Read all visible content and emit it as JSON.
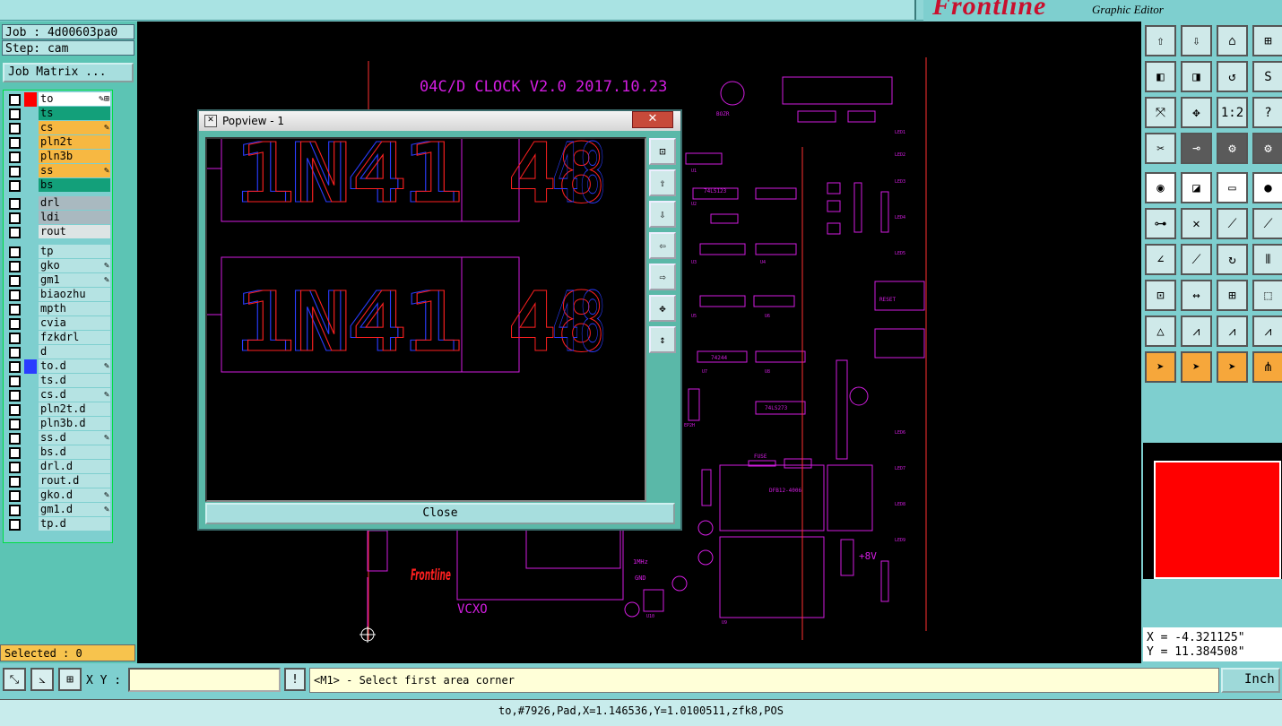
{
  "app": {
    "brand": "Frontline",
    "subtitle": "Graphic Editor"
  },
  "job": {
    "job_line": "Job : 4d00603pa0",
    "step_line": "Step: cam",
    "matrix_button": "Job Matrix ..."
  },
  "layer_groups": [
    [
      {
        "name": "to",
        "color": "#ff0000",
        "bg": "#ffffff",
        "edit": "✎⊞"
      },
      {
        "name": "ts",
        "color": "",
        "bg": "#13a07a",
        "edit": ""
      },
      {
        "name": "cs",
        "color": "",
        "bg": "#f7b842",
        "edit": "✎"
      },
      {
        "name": "pln2t",
        "color": "",
        "bg": "#f7b842",
        "edit": ""
      },
      {
        "name": "pln3b",
        "color": "",
        "bg": "#f7b842",
        "edit": ""
      },
      {
        "name": "ss",
        "color": "",
        "bg": "#f7b842",
        "edit": "✎"
      },
      {
        "name": "bs",
        "color": "",
        "bg": "#13a07a",
        "edit": ""
      }
    ],
    [
      {
        "name": "drl",
        "color": "",
        "bg": "#a9b9c0",
        "edit": ""
      },
      {
        "name": "ldi",
        "color": "",
        "bg": "#a9b9c0",
        "edit": ""
      },
      {
        "name": "rout",
        "color": "",
        "bg": "#dde4e4",
        "edit": ""
      }
    ],
    [
      {
        "name": "tp",
        "color": "",
        "bg": "#b5e3e3",
        "edit": ""
      },
      {
        "name": "gko",
        "color": "",
        "bg": "#b5e3e3",
        "edit": "✎"
      },
      {
        "name": "gm1",
        "color": "",
        "bg": "#b5e3e3",
        "edit": "✎"
      },
      {
        "name": "biaozhu",
        "color": "",
        "bg": "#b5e3e3",
        "edit": ""
      },
      {
        "name": "mpth",
        "color": "",
        "bg": "#b5e3e3",
        "edit": ""
      },
      {
        "name": "cvia",
        "color": "",
        "bg": "#b5e3e3",
        "edit": ""
      },
      {
        "name": "fzkdrl",
        "color": "",
        "bg": "#b5e3e3",
        "edit": ""
      },
      {
        "name": "d",
        "color": "",
        "bg": "#b5e3e3",
        "edit": ""
      },
      {
        "name": "to.d",
        "color": "#2a3cff",
        "bg": "#b5e3e3",
        "edit": "✎"
      },
      {
        "name": "ts.d",
        "color": "",
        "bg": "#b5e3e3",
        "edit": ""
      },
      {
        "name": "cs.d",
        "color": "",
        "bg": "#b5e3e3",
        "edit": "✎"
      },
      {
        "name": "pln2t.d",
        "color": "",
        "bg": "#b5e3e3",
        "edit": ""
      },
      {
        "name": "pln3b.d",
        "color": "",
        "bg": "#b5e3e3",
        "edit": ""
      },
      {
        "name": "ss.d",
        "color": "",
        "bg": "#b5e3e3",
        "edit": "✎"
      },
      {
        "name": "bs.d",
        "color": "",
        "bg": "#b5e3e3",
        "edit": ""
      },
      {
        "name": "drl.d",
        "color": "",
        "bg": "#b5e3e3",
        "edit": ""
      },
      {
        "name": "rout.d",
        "color": "",
        "bg": "#b5e3e3",
        "edit": ""
      },
      {
        "name": "gko.d",
        "color": "",
        "bg": "#b5e3e3",
        "edit": "✎"
      },
      {
        "name": "gm1.d",
        "color": "",
        "bg": "#b5e3e3",
        "edit": "✎"
      },
      {
        "name": "tp.d",
        "color": "",
        "bg": "#b5e3e3",
        "edit": ""
      }
    ]
  ],
  "selected": "Selected : 0",
  "board": {
    "title": "04C/D CLOCK V2.0 2017.10.23",
    "labels": [
      "U1",
      "U2",
      "U3",
      "U4",
      "U5",
      "U6",
      "U7",
      "U8",
      "U9",
      "U10",
      "RESET",
      "74LS123",
      "74244",
      "74LS273",
      "EP2H",
      "DFB12-4006",
      "FUSE",
      "+8V",
      "GND",
      "1MHz",
      "VCXO",
      "BOZR",
      "LED1",
      "LED2",
      "LED3",
      "LED4",
      "LED5",
      "LED6",
      "LED7",
      "LED8",
      "LED9"
    ]
  },
  "popup": {
    "title": "Popview - 1",
    "close_x": "✕",
    "close_label": "Close",
    "text_rows": [
      [
        "1N41",
        "48"
      ],
      [
        "1N41",
        "48"
      ]
    ]
  },
  "toolbar_rows": [
    [
      "⇧",
      "⇩",
      "⌂",
      "⊞"
    ],
    [
      "◧",
      "◨",
      "↺",
      "S"
    ],
    [
      "⤧",
      "✥",
      "1:2",
      "?"
    ],
    [
      "✂",
      "⊸",
      "⚙",
      "⚙"
    ],
    [
      "◉",
      "◪",
      "▭",
      "●"
    ],
    [
      "⊶",
      "✕",
      "⟋",
      "⟋"
    ],
    [
      "∠",
      "⟋",
      "↻",
      "⫴"
    ],
    [
      "⊡",
      "↔",
      "⊞",
      "⬚"
    ],
    [
      "△",
      "⩘",
      "⩘",
      "⩘"
    ],
    [
      "➤",
      "➤",
      "➤",
      "⋔"
    ]
  ],
  "coords": {
    "x": "X = -4.321125\"",
    "y": "Y = 11.384508\""
  },
  "bottom": {
    "xy_label": "X Y :",
    "xy_value": "",
    "bang": "!",
    "message": "<M1> - Select first area corner",
    "unit": "Inch"
  },
  "status": "to,#7926,Pad,X=1.146536,Y=1.0100511,zfk8,POS"
}
